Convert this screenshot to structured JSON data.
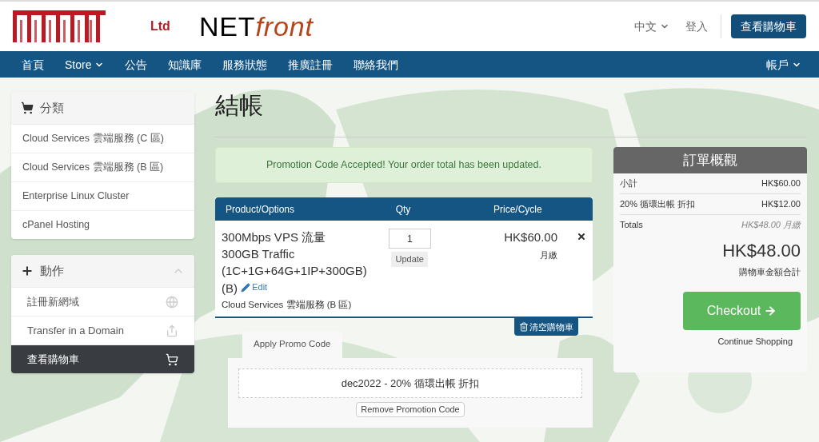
{
  "header": {
    "logo_suffix": "Ltd",
    "brand": {
      "part1": "NET",
      "part2": "front"
    },
    "language": "中文",
    "login": "登入",
    "cart_button": "查看購物車"
  },
  "nav": {
    "items": [
      {
        "label": "首頁",
        "dropdown": false
      },
      {
        "label": "Store",
        "dropdown": true
      },
      {
        "label": "公告",
        "dropdown": false
      },
      {
        "label": "知識庫",
        "dropdown": false
      },
      {
        "label": "服務狀態",
        "dropdown": false
      },
      {
        "label": "推廣註冊",
        "dropdown": false
      },
      {
        "label": "聯絡我們",
        "dropdown": false
      }
    ],
    "account": {
      "label": "帳戶",
      "dropdown": true
    }
  },
  "sidebar": {
    "categories": {
      "title": "分類",
      "items": [
        {
          "label": "Cloud Services 雲端服務 (C 區)",
          "selected": false
        },
        {
          "label": "Cloud Services 雲端服務 (B 區)",
          "selected": false
        },
        {
          "label": "Enterprise Linux Cluster",
          "selected": false
        },
        {
          "label": "cPanel Hosting",
          "selected": false
        }
      ]
    },
    "actions": {
      "title": "動作",
      "expanded": true,
      "items": [
        {
          "label": "註冊新網域",
          "kind": "domain",
          "selected": false
        },
        {
          "label": "Transfer in a Domain",
          "kind": "transfer",
          "selected": false
        },
        {
          "label": "查看購物車",
          "kind": "cart",
          "selected": true
        }
      ]
    }
  },
  "page_title": "結帳",
  "alert": "Promotion Code Accepted! Your order total has been updated.",
  "cart": {
    "columns": [
      "Product/Options",
      "Qty",
      "Price/Cycle"
    ],
    "items": [
      {
        "name": "300Mbps VPS 流量 300GB Traffic (1C+1G+64G+1IP+300GB) (B)",
        "edit": "Edit",
        "group": "Cloud Services 雲端服務 (B 區)",
        "qty": "1",
        "update": "Update",
        "price": "HK$60.00",
        "cycle": "月繳"
      }
    ],
    "empty_button": "清空購物車"
  },
  "promo": {
    "tab": "Apply Promo Code",
    "code": "dec2022 - 20% 循環出帳 折扣",
    "remove": "Remove Promotion Code"
  },
  "summary": {
    "title": "訂單概觀",
    "rows": [
      {
        "label": "小計",
        "value": "HK$60.00"
      },
      {
        "label": "20% 循環出帳 折扣",
        "value": "HK$12.00"
      }
    ],
    "totals_label": "Totals",
    "totals_value": "HK$48.00 月繳",
    "total": "HK$48.00",
    "total_caption": "購物車金額合計",
    "checkout": "Checkout",
    "continue": "Continue Shopping"
  }
}
